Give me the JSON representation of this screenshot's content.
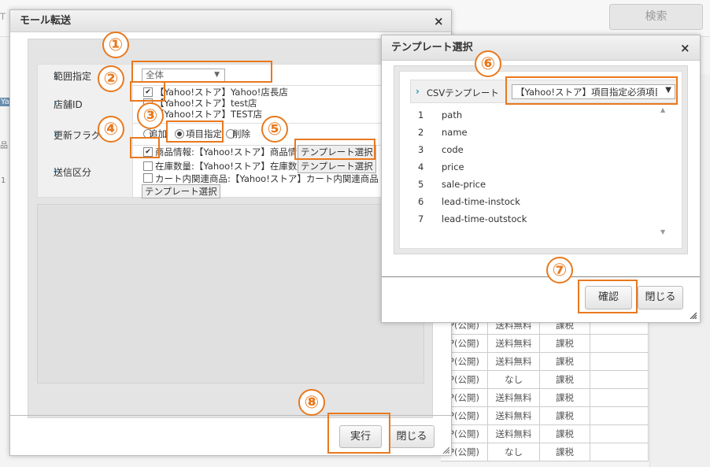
{
  "background": {
    "left_top_fragment": "T",
    "left_fragments": [
      "Ya",
      "品",
      "1"
    ],
    "search_button": "検索",
    "table_rows": [
      [
        "P(公開)",
        "送料無料",
        "課税"
      ],
      [
        "P(公開)",
        "送料無料",
        "課税"
      ],
      [
        "P(公開)",
        "送料無料",
        "課税"
      ],
      [
        "P(公開)",
        "なし",
        "課税"
      ],
      [
        "P(公開)",
        "送料無料",
        "課税"
      ],
      [
        "P(公開)",
        "送料無料",
        "課税"
      ],
      [
        "P(公開)",
        "送料無料",
        "課税"
      ],
      [
        "P(公開)",
        "なし",
        "課税"
      ]
    ]
  },
  "mall_dialog": {
    "title": "モール転送",
    "close": "×",
    "range_label": "範囲指定",
    "range_value": "全体",
    "shop_label": "店舗ID",
    "shops": [
      {
        "label": "【Yahoo!ストア】Yahoo!店長店",
        "checked": true
      },
      {
        "label": "【Yahoo!ストア】test店",
        "checked": false
      },
      {
        "label": "【Yahoo!ストア】TEST店",
        "checked": false
      }
    ],
    "update_label": "更新フラグ",
    "update_options": [
      "追加",
      "項目指定",
      "削除"
    ],
    "update_selected": "項目指定",
    "send_label": "送信区分",
    "send_items": [
      {
        "label": "商品情報:【Yahoo!ストア】商品情報",
        "checked": true,
        "button": "テンプレート選択"
      },
      {
        "label": "在庫数量:【Yahoo!ストア】在庫数量",
        "checked": false,
        "button": "テンプレート選択"
      },
      {
        "label": "カート内関連商品:【Yahoo!ストア】カート内関連商品",
        "checked": false,
        "button": "テンプレート選択"
      }
    ],
    "execute_button": "実行",
    "close_button": "閉じる"
  },
  "template_dialog": {
    "title": "テンプレート選択",
    "close": "×",
    "csv_label": "CSVテンプレート",
    "csv_value": "【Yahoo!ストア】項目指定必須項目",
    "fields": [
      {
        "n": "1",
        "name": "path"
      },
      {
        "n": "2",
        "name": "name"
      },
      {
        "n": "3",
        "name": "code"
      },
      {
        "n": "4",
        "name": "price"
      },
      {
        "n": "5",
        "name": "sale-price"
      },
      {
        "n": "6",
        "name": "lead-time-instock"
      },
      {
        "n": "7",
        "name": "lead-time-outstock"
      }
    ],
    "confirm_button": "確認",
    "close_button": "閉じる"
  },
  "callouts": [
    "①",
    "②",
    "③",
    "④",
    "⑤",
    "⑥",
    "⑦",
    "⑧"
  ],
  "colors": {
    "highlight": "#e8791f",
    "chevron": "#2a8fc0"
  }
}
